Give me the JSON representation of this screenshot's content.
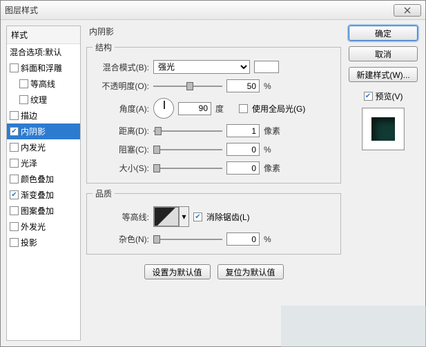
{
  "window": {
    "title": "图层样式",
    "close": "×"
  },
  "sidebar": {
    "header": "样式",
    "blend_defaults": "混合选项:默认",
    "items": [
      {
        "label": "斜面和浮雕",
        "checked": false,
        "sub": false
      },
      {
        "label": "等高线",
        "checked": false,
        "sub": true
      },
      {
        "label": "纹理",
        "checked": false,
        "sub": true
      },
      {
        "label": "描边",
        "checked": false,
        "sub": false
      },
      {
        "label": "内阴影",
        "checked": true,
        "sub": false,
        "selected": true
      },
      {
        "label": "内发光",
        "checked": false,
        "sub": false
      },
      {
        "label": "光泽",
        "checked": false,
        "sub": false
      },
      {
        "label": "颜色叠加",
        "checked": false,
        "sub": false
      },
      {
        "label": "渐变叠加",
        "checked": true,
        "sub": false
      },
      {
        "label": "图案叠加",
        "checked": false,
        "sub": false
      },
      {
        "label": "外发光",
        "checked": false,
        "sub": false
      },
      {
        "label": "投影",
        "checked": false,
        "sub": false
      }
    ]
  },
  "panel": {
    "title": "内阴影",
    "structure": {
      "legend": "结构",
      "blend_mode_label": "混合模式(B):",
      "blend_mode_value": "强光",
      "opacity_label": "不透明度(O):",
      "opacity_value": "50",
      "opacity_unit": "%",
      "angle_label": "角度(A):",
      "angle_value": "90",
      "angle_unit": "度",
      "global_light_label": "使用全局光(G)",
      "global_light_checked": false,
      "distance_label": "距离(D):",
      "distance_value": "1",
      "distance_unit": "像素",
      "choke_label": "阻塞(C):",
      "choke_value": "0",
      "choke_unit": "%",
      "size_label": "大小(S):",
      "size_value": "0",
      "size_unit": "像素"
    },
    "quality": {
      "legend": "品质",
      "contour_label": "等高线:",
      "antialias_label": "消除锯齿(L)",
      "antialias_checked": true,
      "noise_label": "杂色(N):",
      "noise_value": "0",
      "noise_unit": "%"
    },
    "buttons": {
      "set_default": "设置为默认值",
      "reset_default": "复位为默认值"
    }
  },
  "right": {
    "ok": "确定",
    "cancel": "取消",
    "new_style": "新建样式(W)...",
    "preview_label": "预览(V)",
    "preview_checked": true
  }
}
